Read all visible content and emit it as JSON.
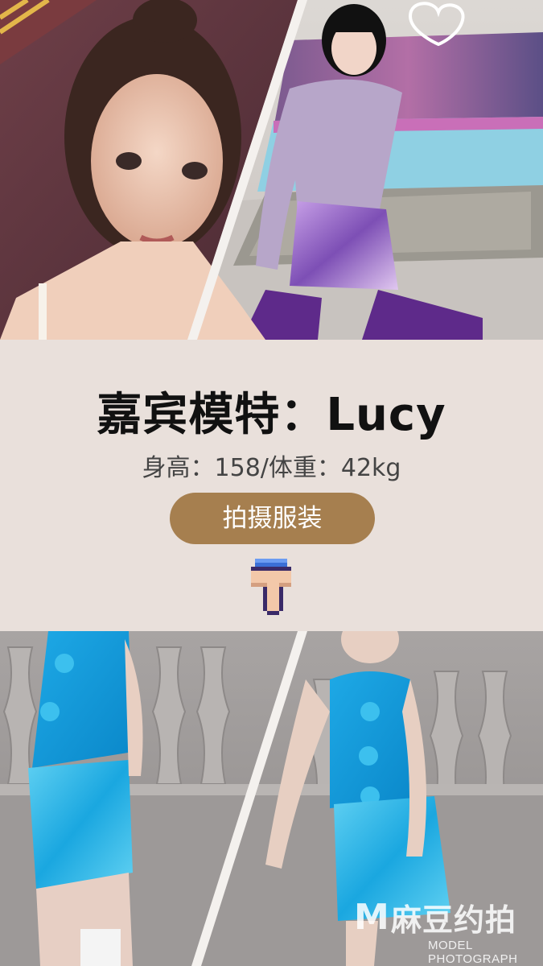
{
  "model": {
    "title": "嘉宾模特：Lucy",
    "stats": "身高：158/体重：42kg"
  },
  "cta": {
    "label": "拍摄服装"
  },
  "icons": {
    "pointer": "pointing-hand-down-icon"
  },
  "watermark": {
    "logo_letter": "M",
    "brand": "麻豆约拍",
    "tagline": "MODEL PHOTOGRAPH"
  },
  "colors": {
    "background": "#e9e0db",
    "button": "#a67f4f",
    "title": "#111111"
  }
}
